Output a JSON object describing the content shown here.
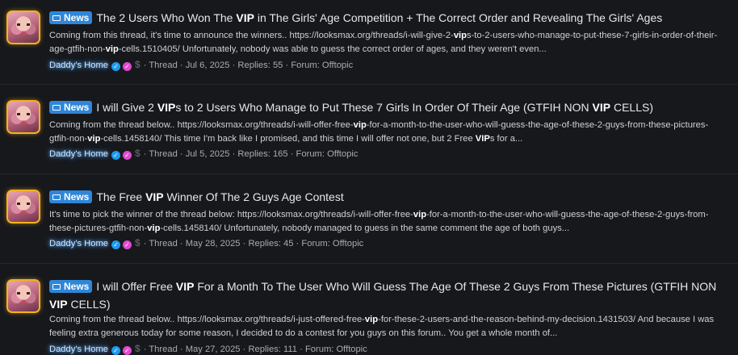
{
  "results": [
    {
      "badge": "News",
      "title_parts": [
        "The 2 Users Who Won The ",
        "VIP",
        " in The Girls' Age Competition + The Correct Order and Revealing The Girls' Ages"
      ],
      "snippet_parts": [
        "Coming from this thread, it's time to announce the winners.. https://looksmax.org/threads/i-will-give-2-",
        "vip",
        "s-to-2-users-who-manage-to-put-these-7-girls-in-order-of-their-age-gtfih-non-",
        "vip",
        "-cells.1510405/ Unfortunately, nobody was able to guess the correct order of ages, and they weren't even..."
      ],
      "author": "Daddy's Home",
      "meta": "· Thread · Jul 6, 2025 · Replies: 55 · Forum: Offtopic"
    },
    {
      "badge": "News",
      "title_parts": [
        "I will Give 2 ",
        "VIP",
        "s to 2 Users Who Manage to Put These 7 Girls In Order Of Their Age (GTFIH NON ",
        "VIP",
        " CELLS)"
      ],
      "snippet_parts": [
        "Coming from the thread below.. https://looksmax.org/threads/i-will-offer-free-",
        "vip",
        "-for-a-month-to-the-user-who-will-guess-the-age-of-these-2-guys-from-these-pictures-gtfih-non-",
        "vip",
        "-cells.1458140/ This time I'm back like I promised, and this time I will offer not one, but 2 Free ",
        "VIP",
        "s for a..."
      ],
      "author": "Daddy's Home",
      "meta": "· Thread · Jul 5, 2025 · Replies: 165 · Forum: Offtopic"
    },
    {
      "badge": "News",
      "title_parts": [
        "The Free ",
        "VIP",
        " Winner Of The 2 Guys Age Contest"
      ],
      "snippet_parts": [
        "It's time to pick the winner of the thread below: https://looksmax.org/threads/i-will-offer-free-",
        "vip",
        "-for-a-month-to-the-user-who-will-guess-the-age-of-these-2-guys-from-these-pictures-gtfih-non-",
        "vip",
        "-cells.1458140/ Unfortunately, nobody managed to guess in the same comment the age of both guys..."
      ],
      "author": "Daddy's Home",
      "meta": "· Thread · May 28, 2025 · Replies: 45 · Forum: Offtopic"
    },
    {
      "badge": "News",
      "title_parts": [
        "I will Offer Free ",
        "VIP",
        " For a Month To The User Who Will Guess The Age Of These 2 Guys From These Pictures (GTFIH NON ",
        "VIP",
        " CELLS)"
      ],
      "snippet_parts": [
        "Coming from the thread below.. https://looksmax.org/threads/i-just-offered-free-",
        "vip",
        "-for-these-2-users-and-the-reason-behind-my-decision.1431503/ And because I was feeling extra generous today for some reason, I decided to do a contest for you guys on this forum.. You get a whole month of..."
      ],
      "author": "Daddy's Home",
      "meta": "· Thread · May 27, 2025 · Replies: 111 · Forum: Offtopic"
    }
  ],
  "colors": {
    "background": "#17181c",
    "badge": "#2f86d8",
    "avatar_border": "#f3b21f",
    "verified": "#1d9bf0",
    "pink_badge": "#e04ad0"
  },
  "icons": [
    "news-flag-icon",
    "verified-check-icon",
    "pink-check-icon",
    "dollar-icon"
  ]
}
